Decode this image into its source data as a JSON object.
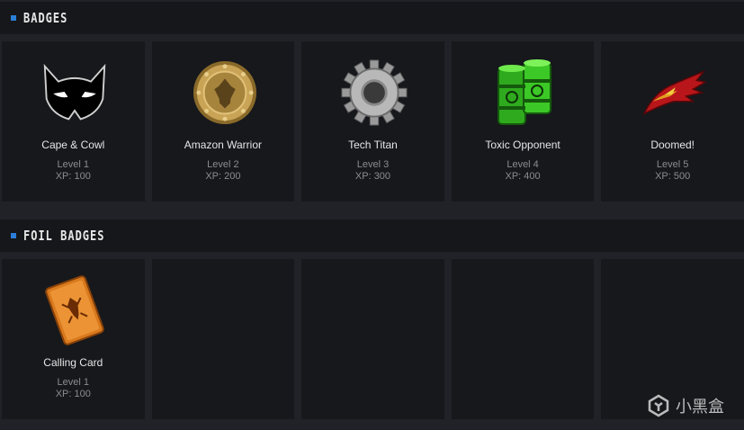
{
  "badges_section": {
    "title": "BADGES",
    "items": [
      {
        "name": "Cape & Cowl",
        "level": "Level 1",
        "xp": "XP: 100",
        "icon": "cowl-mask-icon"
      },
      {
        "name": "Amazon Warrior",
        "level": "Level 2",
        "xp": "XP: 200",
        "icon": "golden-shield-icon"
      },
      {
        "name": "Tech Titan",
        "level": "Level 3",
        "xp": "XP: 300",
        "icon": "gear-icon"
      },
      {
        "name": "Toxic Opponent",
        "level": "Level 4",
        "xp": "XP: 400",
        "icon": "toxic-barrels-icon"
      },
      {
        "name": "Doomed!",
        "level": "Level 5",
        "xp": "XP: 500",
        "icon": "torn-cape-icon"
      }
    ]
  },
  "foil_section": {
    "title": "FOIL BADGES",
    "items": [
      {
        "name": "Calling Card",
        "level": "Level 1",
        "xp": "XP: 100",
        "icon": "calling-card-icon"
      }
    ]
  },
  "watermark": {
    "text": "小黑盒"
  },
  "colors": {
    "accent": "#2b7fd8",
    "tile_bg": "#16181c",
    "page_bg": "#202228"
  }
}
